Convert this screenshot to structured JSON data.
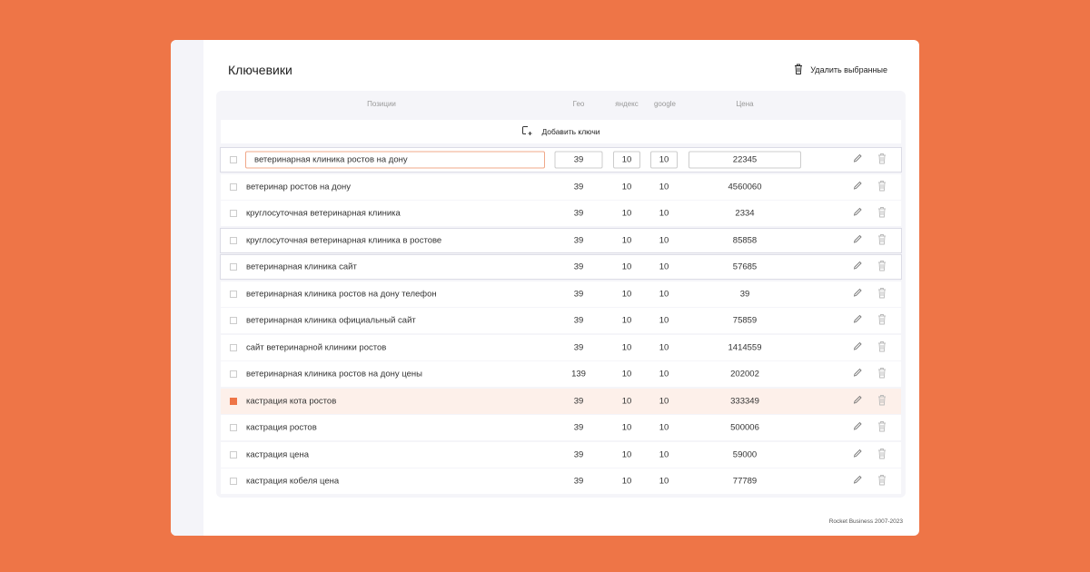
{
  "title": "Ключевики",
  "delete_selected": "Удалить выбранные",
  "headers": {
    "positions": "Позиции",
    "geo": "Гео",
    "yandex": "яндекс",
    "google": "google",
    "price": "Цена"
  },
  "add_keys": "Добавить ключи",
  "rows": [
    {
      "keyword": "ветеринарная клиника ростов на дону",
      "geo": "39",
      "yandex": "10",
      "google": "10",
      "price": "22345",
      "editing": true
    },
    {
      "keyword": "ветеринар ростов на дону",
      "geo": "39",
      "yandex": "10",
      "google": "10",
      "price": "4560060"
    },
    {
      "keyword": "круглосуточная ветеринарная клиника",
      "geo": "39",
      "yandex": "10",
      "google": "10",
      "price": "2334"
    },
    {
      "keyword": "круглосуточная ветеринарная клиника в ростове",
      "geo": "39",
      "yandex": "10",
      "google": "10",
      "price": "85858",
      "outlined": true
    },
    {
      "keyword": "ветеринарная клиника сайт",
      "geo": "39",
      "yandex": "10",
      "google": "10",
      "price": "57685",
      "outlined": true
    },
    {
      "keyword": "ветеринарная клиника ростов на дону телефон",
      "geo": "39",
      "yandex": "10",
      "google": "10",
      "price": "39"
    },
    {
      "keyword": "ветеринарная клиника официальный сайт",
      "geo": "39",
      "yandex": "10",
      "google": "10",
      "price": "75859"
    },
    {
      "keyword": "сайт ветеринарной клиники ростов",
      "geo": "39",
      "yandex": "10",
      "google": "10",
      "price": "1414559"
    },
    {
      "keyword": "ветеринарная клиника ростов на дону цены",
      "geo": "139",
      "yandex": "10",
      "google": "10",
      "price": "202002"
    },
    {
      "keyword": "кастрация кота ростов",
      "geo": "39",
      "yandex": "10",
      "google": "10",
      "price": "333349",
      "checked": true
    },
    {
      "keyword": "кастрация ростов",
      "geo": "39",
      "yandex": "10",
      "google": "10",
      "price": "500006"
    },
    {
      "keyword": "кастрация цена",
      "geo": "39",
      "yandex": "10",
      "google": "10",
      "price": "59000"
    },
    {
      "keyword": "кастрация кобеля цена",
      "geo": "39",
      "yandex": "10",
      "google": "10",
      "price": "77789"
    }
  ],
  "footer": "Rocket Business 2007-2023",
  "colors": {
    "accent": "#ee7547"
  }
}
